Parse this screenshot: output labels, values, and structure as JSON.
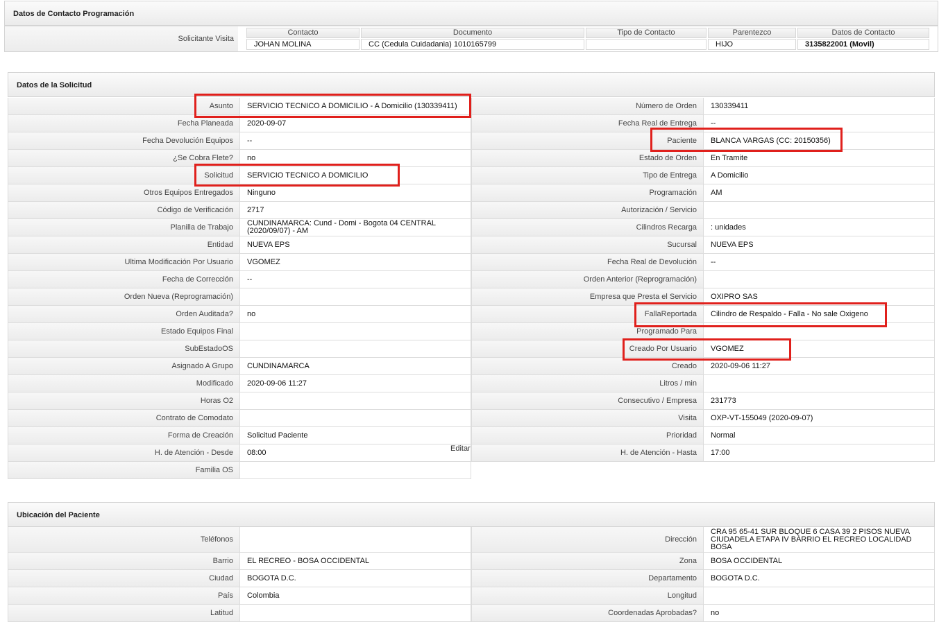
{
  "contact_section": {
    "title": "Datos de Contacto Programación",
    "row_label": "Solicitante Visita",
    "headers": [
      "Contacto",
      "Documento",
      "Tipo de Contacto",
      "Parentezco",
      "Datos de Contacto"
    ],
    "values": [
      "JOHAN MOLINA",
      "CC (Cedula Cuidadania) 1010165799",
      "",
      "HIJO",
      "3135822001 (Movil)"
    ]
  },
  "solicitud_section": {
    "title": "Datos de la Solicitud",
    "left": [
      {
        "label": "Asunto",
        "value": "SERVICIO TECNICO A DOMICILIO - A Domicilio (130339411)"
      },
      {
        "label": "Fecha Planeada",
        "value": "2020-09-07"
      },
      {
        "label": "Fecha Devolución Equipos",
        "value": "--"
      },
      {
        "label": "¿Se Cobra Flete?",
        "value": "no"
      },
      {
        "label": "Solicitud",
        "value": "SERVICIO TECNICO A DOMICILIO"
      },
      {
        "label": "Otros Equipos Entregados",
        "value": "Ninguno"
      },
      {
        "label": "Código de Verificación",
        "value": "2717"
      },
      {
        "label": "Planilla de Trabajo",
        "value": "CUNDINAMARCA: Cund - Domi - Bogota 04 CENTRAL (2020/09/07) - AM"
      },
      {
        "label": "Entidad",
        "value": "NUEVA EPS"
      },
      {
        "label": "Ultima Modificación Por Usuario",
        "value": "VGOMEZ"
      },
      {
        "label": "Fecha de Corrección",
        "value": "--"
      },
      {
        "label": "Orden Nueva (Reprogramación)",
        "value": ""
      },
      {
        "label": "Orden Auditada?",
        "value": "no"
      },
      {
        "label": "Estado Equipos Final",
        "value": ""
      },
      {
        "label": "SubEstadoOS",
        "value": ""
      },
      {
        "label": "Asignado A Grupo",
        "value": "CUNDINAMARCA"
      },
      {
        "label": "Modificado",
        "value": "2020-09-06 11:27"
      },
      {
        "label": "Horas O2",
        "value": ""
      },
      {
        "label": "Contrato de Comodato",
        "value": ""
      },
      {
        "label": "Forma de Creación",
        "value": "Solicitud Paciente"
      },
      {
        "label": "H. de Atención - Desde",
        "value": "08:00"
      },
      {
        "label": "Familia OS",
        "value": ""
      }
    ],
    "right": [
      {
        "label": "Número de Orden",
        "value": "130339411"
      },
      {
        "label": "Fecha Real de Entrega",
        "value": "--"
      },
      {
        "label": "Paciente",
        "value": "BLANCA VARGAS (CC: 20150356)"
      },
      {
        "label": "Estado de Orden",
        "value": "En Tramite"
      },
      {
        "label": "Tipo de Entrega",
        "value": "A Domicilio"
      },
      {
        "label": "Programación",
        "value": "AM"
      },
      {
        "label": "Autorización / Servicio",
        "value": ""
      },
      {
        "label": "Cilindros Recarga",
        "value": ": unidades"
      },
      {
        "label": "Sucursal",
        "value": "NUEVA EPS"
      },
      {
        "label": "Fecha Real de Devolución",
        "value": "--"
      },
      {
        "label": "Orden Anterior (Reprogramación)",
        "value": ""
      },
      {
        "label": "Empresa que Presta el Servicio",
        "value": "OXIPRO SAS"
      },
      {
        "label": "FallaReportada",
        "value": "Cilindro de Respaldo - Falla - No sale Oxigeno"
      },
      {
        "label": "Programado Para",
        "value": ""
      },
      {
        "label": "Creado Por Usuario",
        "value": "VGOMEZ"
      },
      {
        "label": "Creado",
        "value": "2020-09-06 11:27"
      },
      {
        "label": "Litros / min",
        "value": ""
      },
      {
        "label": "Consecutivo / Empresa",
        "value": "231773"
      },
      {
        "label": "Visita",
        "value": "OXP-VT-155049 (2020-09-07)"
      },
      {
        "label": "Prioridad",
        "value": "Normal"
      },
      {
        "label": "H. de Atención - Hasta",
        "value": "17:00"
      }
    ],
    "edit_link": "Editar"
  },
  "ubicacion_section": {
    "title": "Ubicación del Paciente",
    "left": [
      {
        "label": "Teléfonos",
        "value": ""
      },
      {
        "label": "Barrio",
        "value": "EL RECREO - BOSA OCCIDENTAL"
      },
      {
        "label": "Ciudad",
        "value": "BOGOTA D.C."
      },
      {
        "label": "País",
        "value": "Colombia"
      },
      {
        "label": "Latitud",
        "value": ""
      }
    ],
    "right": [
      {
        "label": "Dirección",
        "value": "CRA 95 65-41 SUR BLOQUE 6 CASA 39 2 PISOS NUEVA CIUDADELA ETAPA IV BARRIO EL RECREO LOCALIDAD BOSA"
      },
      {
        "label": "Zona",
        "value": "BOSA OCCIDENTAL"
      },
      {
        "label": "Departamento",
        "value": "BOGOTA D.C."
      },
      {
        "label": "Longitud",
        "value": ""
      },
      {
        "label": "Coordenadas Aprobadas?",
        "value": "no"
      }
    ]
  },
  "colors": {
    "highlight": "#e0201c",
    "header_bg": "#eeeeee",
    "border": "#d4d4d4"
  }
}
